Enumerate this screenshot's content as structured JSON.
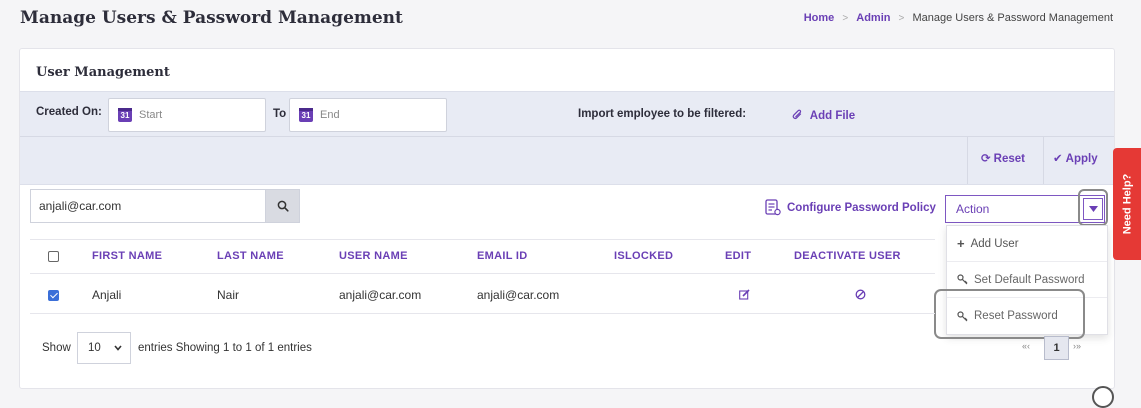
{
  "page": {
    "title": "Manage Users & Password Management"
  },
  "breadcrumb": {
    "home": "Home",
    "admin": "Admin",
    "current": "Manage Users & Password Management",
    "separator": ">"
  },
  "card": {
    "title": "User Management"
  },
  "filters": {
    "created_on_label": "Created On:",
    "start_placeholder": "Start",
    "to_label": "To",
    "end_placeholder": "End",
    "calendar_day": "31",
    "import_label": "Import employee to be filtered:",
    "add_file_label": "Add File",
    "reset_label": "Reset",
    "apply_label": "Apply"
  },
  "search": {
    "value": "anjali@car.com"
  },
  "toolbar": {
    "configure_policy_label": "Configure Password Policy",
    "action_label": "Action"
  },
  "action_menu": {
    "items": [
      {
        "icon": "plus-icon",
        "label": "Add User"
      },
      {
        "icon": "key-icon",
        "label": "Set Default Password"
      },
      {
        "icon": "key-icon",
        "label": "Reset Password"
      }
    ]
  },
  "table": {
    "headers": [
      "FIRST NAME",
      "LAST NAME",
      "USER NAME",
      "EMAIL ID",
      "ISLOCKED",
      "EDIT",
      "DEACTIVATE USER"
    ],
    "rows": [
      {
        "checked": true,
        "first_name": "Anjali",
        "last_name": "Nair",
        "user_name": "anjali@car.com",
        "email": "anjali@car.com",
        "islocked": "",
        "edit_icon": "edit-icon",
        "deactivate_icon": "ban-icon"
      }
    ]
  },
  "footer": {
    "show_label": "Show",
    "page_length": "10",
    "info": "entries Showing 1 to 1 of 1 entries",
    "current_page": "1"
  },
  "help": {
    "label": "Need Help?"
  },
  "colors": {
    "accent": "#6a3fb5",
    "filter_bg": "#e8ebf4",
    "help_bg": "#e53935",
    "checkbox": "#3b6fd8"
  }
}
